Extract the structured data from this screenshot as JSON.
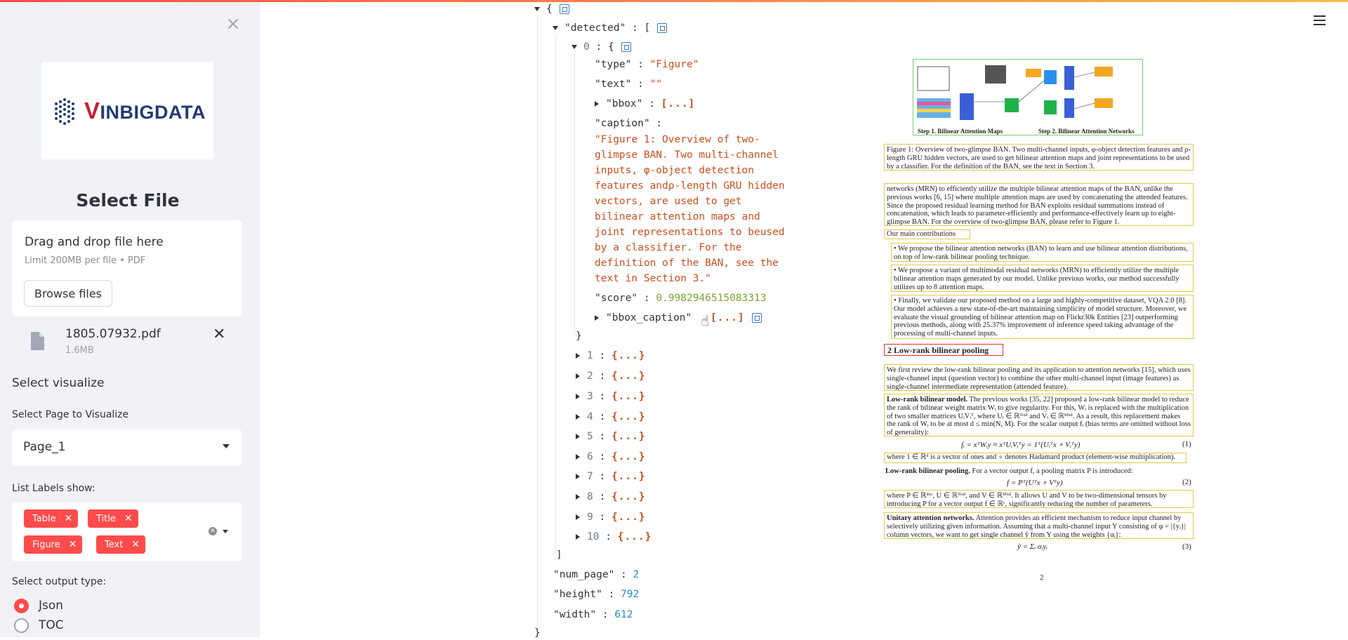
{
  "sidebar": {
    "close_icon": "close-icon",
    "logo_text_v": "V",
    "logo_text_rest": "INBIGDATA",
    "title": "Select File",
    "dropzone": {
      "title": "Drag and drop file here",
      "subtitle": "Limit 200MB per file • PDF",
      "browse_label": "Browse files"
    },
    "file": {
      "name": "1805.07932.pdf",
      "size": "1.6MB"
    },
    "section_title": "Select visualize",
    "page_label": "Select Page to Visualize",
    "page_value": "Page_1",
    "labels_label": "List Labels show:",
    "labels": [
      "Table",
      "Title",
      "Figure",
      "Text"
    ],
    "output_label": "Select output type:",
    "output_options": [
      "Json",
      "TOC"
    ],
    "output_selected": "Json"
  },
  "json_view": {
    "open_brace": "{",
    "detected_key": "\"detected\"",
    "open_bracket": "[",
    "item0_index": "0",
    "type_key": "\"type\"",
    "type_value": "\"Figure\"",
    "text_key": "\"text\"",
    "text_value": "\"\"",
    "bbox_key": "\"bbox\"",
    "collapsed_array": "[...]",
    "caption_key": "\"caption\"",
    "caption_value": "\"Figure 1: Overview of two-\nglimpse BAN. Two multi-channel\ninputs, φ-object detection\nfeatures andρ-length GRU hidden\nvectors, are used to get\nbilinear attention maps and\njoint representations to beused\nby a classifier. For the\ndefinition of the BAN, see the\ntext in Section 3.\"",
    "score_key": "\"score\"",
    "score_value": "0.9982946515083313",
    "bbox_caption_key": "\"bbox_caption\"",
    "close_brace": "}",
    "collapsed_items": [
      "1",
      "2",
      "3",
      "4",
      "5",
      "6",
      "7",
      "8",
      "9",
      "10"
    ],
    "collapsed_object": "{...}",
    "close_bracket": "]",
    "num_page_key": "\"num_page\"",
    "num_page_value": "2",
    "height_key": "\"height\"",
    "height_value": "792",
    "width_key": "\"width\"",
    "width_value": "612"
  },
  "doc_preview": {
    "fig_step1": "Step 1. Bilinear Attention Maps",
    "fig_step2": "Step 2. Bilinear Attention Networks",
    "fig_caption": "Figure 1: Overview of two-glimpse BAN. Two multi-channel inputs, φ-object detection features and ρ-length GRU hidden vectors, are used to get bilinear attention maps and joint representations to be used by a classifier. For the definition of the BAN, see the text in Section 3.",
    "para1": "networks (MRN) to efficiently utilize the multiple bilinear attention maps of the BAN, unlike the previous works [6, 15] where multiple attention maps are used by concatenating the attended features. Since the proposed residual learning method for BAN exploits residual summations instead of concatenation, which leads to parameter-efficiently and performance-effectively learn up to eight-glimpse BAN. For the overview of two-glimpse BAN, please refer to Figure 1.",
    "contrib_title": "Our main contributions are:",
    "bullets": [
      "We propose the bilinear attention networks (BAN) to learn and use bilinear attention distributions, on top of low-rank bilinear pooling technique.",
      "We propose a variant of multimodal residual networks (MRN) to efficiently utilize the multiple bilinear attention maps generated by our model. Unlike previous works, our method successfully utilizes up to 8 attention maps.",
      "Finally, we validate our proposed method on a large and highly-competitive dataset, VQA 2.0 [8]. Our model achieves a new state-of-the-art maintaining simplicity of model structure. Moreover, we evaluate the visual grounding of bilinear attention map on Flickr30k Entities [23] outperforming previous methods, along with 25.37% improvement of inference speed taking advantage of the processing of multi-channel inputs."
    ],
    "section_title": "2   Low-rank bilinear pooling",
    "para2": "We first review the low-rank bilinear pooling and its application to attention networks [15], which uses single-channel input (question vector) to combine the other multi-channel input (image features) as single-channel intermediate representation (attended feature).",
    "para3_head": "Low-rank bilinear model.",
    "para3": " The previous works [35, 22] proposed a low-rank bilinear model to reduce the rank of bilinear weight matrix Wᵢ to give regularity. For this, Wᵢ is replaced with the multiplication of two smaller matrices UᵢVᵢᵀ, where Uᵢ ∈ ℝᴺˣᵈ and Vᵢ ∈ ℝᴹˣᵈ. As a result, this replacement makes the rank of Wᵢ to be at most d ≤ min(N, M). For the scalar output fᵢ (bias terms are omitted without loss of generality):",
    "eq1": "fᵢ = xᵀWᵢy ≈ xᵀUᵢVᵢᵀy = 1ᵀ(Uᵢᵀx ∘ Vᵢᵀy)",
    "eq1_no": "(1)",
    "para4": "where 1 ∈ ℝᵈ is a vector of ones and ∘ denotes Hadamard product (element-wise multiplication).",
    "para5_head": "Low-rank bilinear pooling.",
    "para5": " For a vector output f, a pooling matrix P is introduced:",
    "eq2": "f = Pᵀ(Uᵀx ∘ Vᵀy)",
    "eq2_no": "(2)",
    "para6": "where P ∈ ℝᵈˣᶜ, U ∈ ℝᴺˣᵈ, and V ∈ ℝᴹˣᵈ. It allows U and V to be two-dimensional tensors by introducing P for a vector output f ∈ ℝᶜ, significantly reducing the number of parameters.",
    "para7_head": "Unitary attention networks.",
    "para7": " Attention provides an efficient mechanism to reduce input channel by selectively utilizing given information. Assuming that a multi-channel input Y consisting of φ = |{yᵢ}| column vectors, we want to get single channel ŷ from Y using the weights {αᵢ}:",
    "eq3": "ŷ = Σᵢ αᵢyᵢ",
    "eq3_no": "(3)",
    "page_number": "2"
  },
  "colors": {
    "accent": "#ff4b4b",
    "string": "#c9501e",
    "number": "#2b8dc7",
    "score": "#7da531",
    "figure_box": "#6fd36f",
    "text_box": "#e2c84b",
    "title_box": "#dd3333"
  }
}
